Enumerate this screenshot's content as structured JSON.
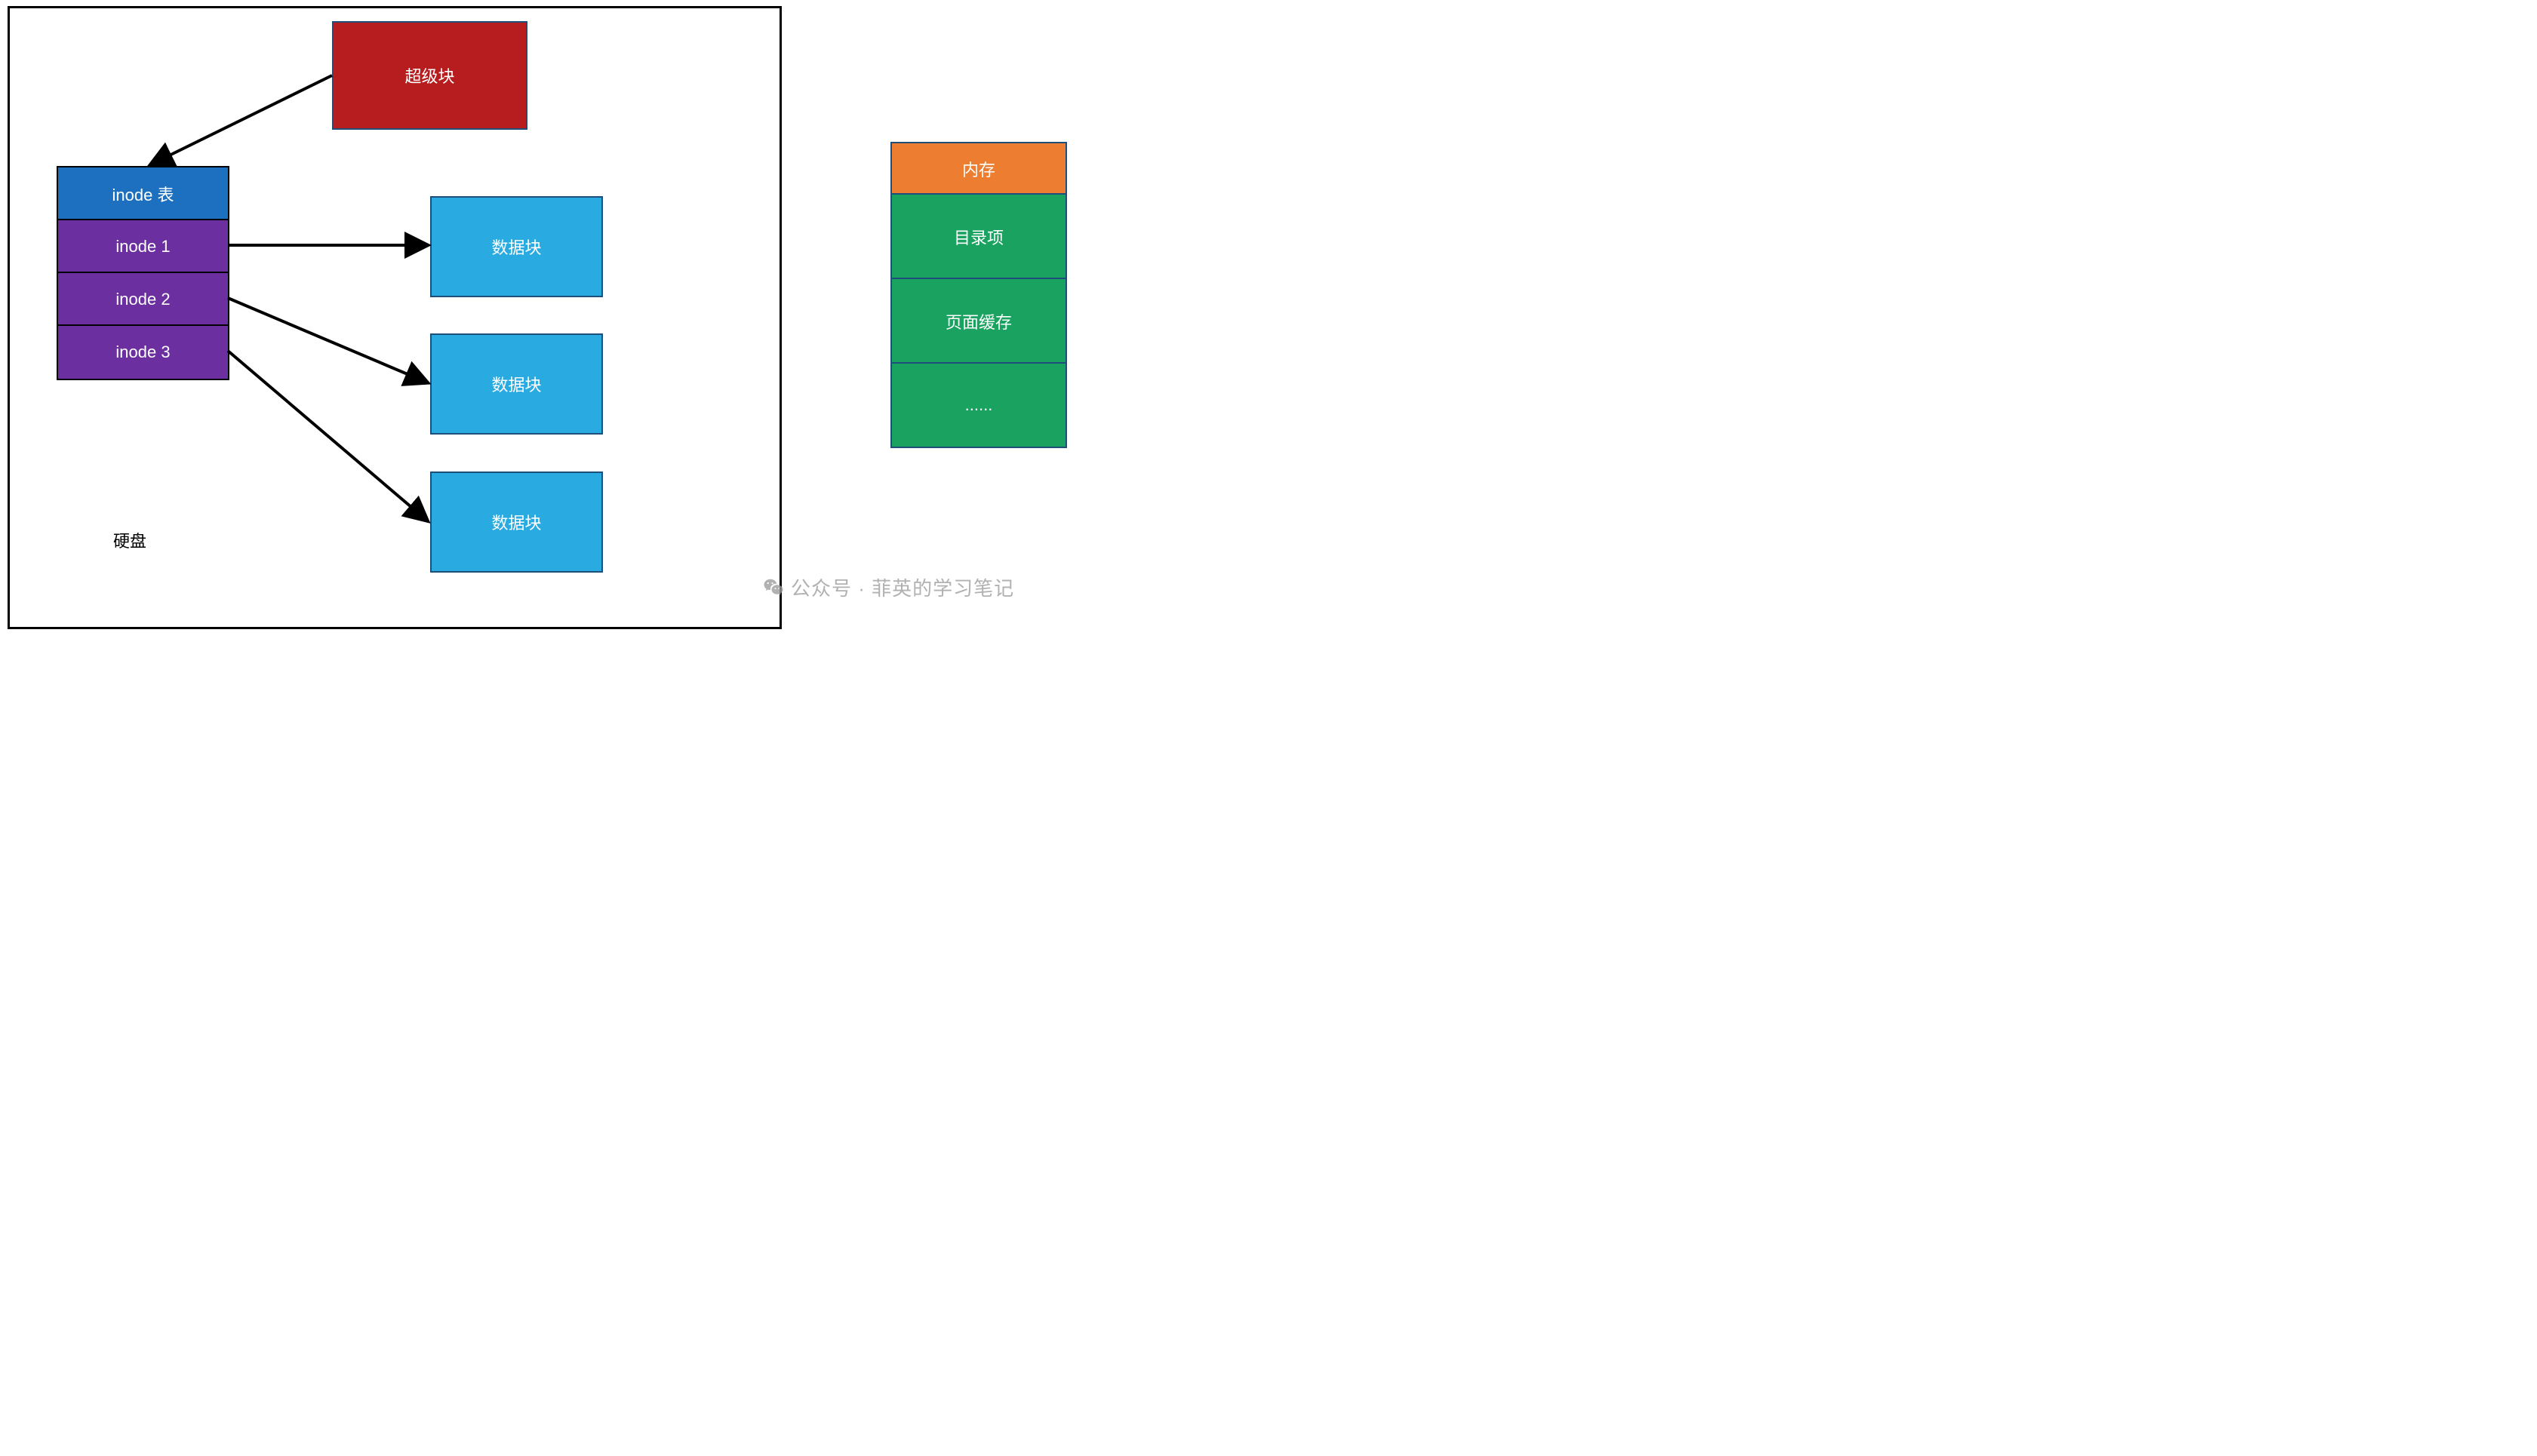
{
  "disk": {
    "label": "硬盘",
    "super_block": "超级块",
    "inode_table": {
      "header": "inode 表",
      "entries": [
        "inode  1",
        "inode  2",
        "inode  3"
      ]
    },
    "data_blocks": [
      "数据块",
      "数据块",
      "数据块"
    ]
  },
  "memory": {
    "header": "内存",
    "cells": [
      "目录项",
      "页面缓存",
      "......"
    ]
  },
  "watermark": "公众号 · 菲英的学习笔记",
  "colors": {
    "super": "#b71d1e",
    "inode_header": "#1d6fbf",
    "inode": "#6b2fa0",
    "data": "#29abe2",
    "mem_header": "#ed7d31",
    "mem_cell": "#1aa260",
    "border": "#1f4e79"
  }
}
